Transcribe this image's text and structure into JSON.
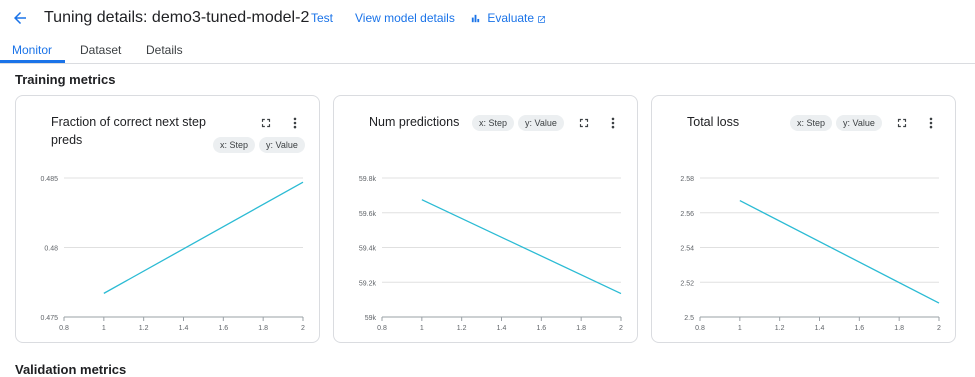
{
  "header": {
    "title": "Tuning details: demo3-tuned-model-2",
    "test_label": "Test",
    "view_model_label": "View model details",
    "evaluate_label": "Evaluate"
  },
  "tabs": [
    {
      "label": "Monitor",
      "active": true
    },
    {
      "label": "Dataset",
      "active": false
    },
    {
      "label": "Details",
      "active": false
    }
  ],
  "sections": {
    "training_title": "Training metrics",
    "validation_title": "Validation metrics"
  },
  "colors": {
    "accent": "#1a73e8",
    "series": "#2bbbd4",
    "grid": "#e0e0e0"
  },
  "icons": [
    "arrow-back-icon",
    "bar-chart-icon",
    "open-in-new-icon",
    "fullscreen-icon",
    "more-vert-icon"
  ],
  "chip_labels": {
    "x": "x: Step",
    "y": "y: Value"
  },
  "charts": [
    {
      "title_line1": "Fraction of correct next step",
      "title_line2": "preds",
      "chart_data": {
        "type": "line",
        "x": [
          1,
          2
        ],
        "y": [
          0.4767,
          0.4847
        ],
        "xlim": [
          0.8,
          2
        ],
        "ylim": [
          0.475,
          0.485
        ],
        "x_ticks": [
          0.8,
          1,
          1.2,
          1.4,
          1.6,
          1.8,
          2
        ],
        "x_tick_labels": [
          "0.8",
          "1",
          "1.2",
          "1.4",
          "1.6",
          "1.8",
          "2"
        ],
        "y_ticks": [
          0.475,
          0.48,
          0.485
        ],
        "y_tick_labels": [
          "0.475",
          "0.48",
          "0.485"
        ],
        "grid": true
      }
    },
    {
      "title_line1": "Num predictions",
      "title_line2": "",
      "chart_data": {
        "type": "line",
        "x": [
          1,
          2
        ],
        "y": [
          59675,
          59135
        ],
        "xlim": [
          0.8,
          2
        ],
        "ylim": [
          59000,
          59800
        ],
        "x_ticks": [
          0.8,
          1,
          1.2,
          1.4,
          1.6,
          1.8,
          2
        ],
        "x_tick_labels": [
          "0.8",
          "1",
          "1.2",
          "1.4",
          "1.6",
          "1.8",
          "2"
        ],
        "y_ticks": [
          59000,
          59200,
          59400,
          59600,
          59800
        ],
        "y_tick_labels": [
          "59k",
          "59.2k",
          "59.4k",
          "59.6k",
          "59.8k"
        ],
        "grid": true
      }
    },
    {
      "title_line1": "Total loss",
      "title_line2": "",
      "chart_data": {
        "type": "line",
        "x": [
          1,
          2
        ],
        "y": [
          2.567,
          2.508
        ],
        "xlim": [
          0.8,
          2
        ],
        "ylim": [
          2.5,
          2.58
        ],
        "x_ticks": [
          0.8,
          1,
          1.2,
          1.4,
          1.6,
          1.8,
          2
        ],
        "x_tick_labels": [
          "0.8",
          "1",
          "1.2",
          "1.4",
          "1.6",
          "1.8",
          "2"
        ],
        "y_ticks": [
          2.5,
          2.52,
          2.54,
          2.56,
          2.58
        ],
        "y_tick_labels": [
          "2.5",
          "2.52",
          "2.54",
          "2.56",
          "2.58"
        ],
        "grid": true
      }
    }
  ]
}
